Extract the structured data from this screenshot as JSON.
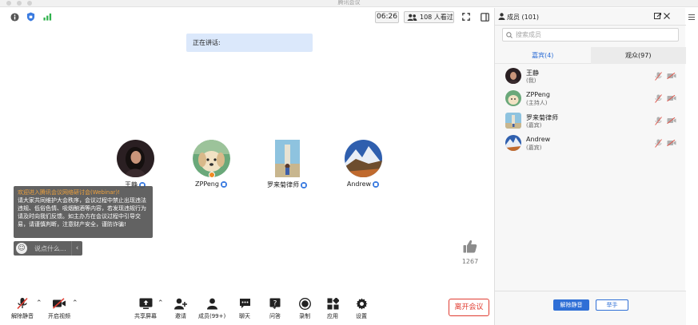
{
  "window": {
    "title": "腾讯会议"
  },
  "topbar": {
    "timer": "06:26",
    "viewers": "108 人看过"
  },
  "stage": {
    "speaking_label": "正在讲话:",
    "participants": [
      {
        "name": "王静"
      },
      {
        "name": "ZPPeng"
      },
      {
        "name": "罗来菊律师"
      },
      {
        "name": "Andrew"
      }
    ],
    "notice": {
      "title": "欢迎进入腾讯会议网络研讨会(Webinar)!",
      "body": "请大家共同维护大会秩序，会议过程中禁止出现违法违规、低俗色情、吸烟酗酒等内容，若发现违规行为请及时向我们反馈。如主办方在会议过程中引导交易，请谨慎判断，注意财产安全，谨防诈骗!"
    },
    "chat": {
      "placeholder": "说点什么..."
    },
    "like_count": "1267"
  },
  "toolbar": {
    "unmute": "解除静音",
    "video": "开启视频",
    "share": "共享屏幕",
    "invite": "邀请",
    "members": "成员(99+)",
    "chat": "聊天",
    "qa": "问答",
    "record": "录制",
    "apps": "应用",
    "settings": "设置",
    "leave": "离开会议"
  },
  "panel": {
    "title": "成员 (101)",
    "search_placeholder": "搜索成员",
    "tabs": [
      {
        "label": "嘉宾(4)"
      },
      {
        "label": "观众(97)"
      }
    ],
    "members": [
      {
        "name": "王静",
        "role": "(我)"
      },
      {
        "name": "ZPPeng",
        "role": "(主持人)"
      },
      {
        "name": "罗来菊律师",
        "role": "(嘉宾)"
      },
      {
        "name": "Andrew",
        "role": "(嘉宾)"
      }
    ],
    "unmute_all": "解除静音",
    "raise_hand": "举手"
  },
  "colors": {
    "accent": "#2f6fd6",
    "danger": "#e03c31",
    "notice_title": "#f0a23c"
  }
}
